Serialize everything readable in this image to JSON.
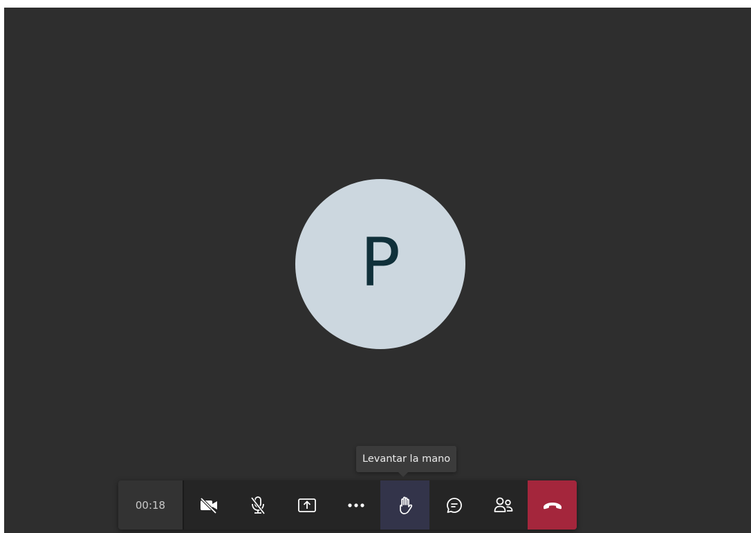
{
  "call": {
    "avatar_initial": "P",
    "timer": "00:18",
    "tooltip": "Levantar la mano"
  },
  "toolbar": {
    "buttons": [
      {
        "name": "camera-off-button",
        "icon": "video-off-icon"
      },
      {
        "name": "mic-off-button",
        "icon": "mic-off-icon"
      },
      {
        "name": "share-screen-button",
        "icon": "share-tray-icon"
      },
      {
        "name": "more-actions-button",
        "icon": "more-icon"
      },
      {
        "name": "raise-hand-button",
        "icon": "hand-icon",
        "state": "hovered"
      },
      {
        "name": "chat-button",
        "icon": "chat-icon"
      },
      {
        "name": "participants-button",
        "icon": "people-icon"
      },
      {
        "name": "hang-up-button",
        "icon": "phone-hangup-icon"
      }
    ]
  },
  "colors": {
    "stage_background": "#2e2e2e",
    "avatar_background": "#ccd7df",
    "avatar_text": "#10303a",
    "toolbar_background": "#252525",
    "hover_background": "#33344a",
    "hangup_background": "#a4263c"
  }
}
